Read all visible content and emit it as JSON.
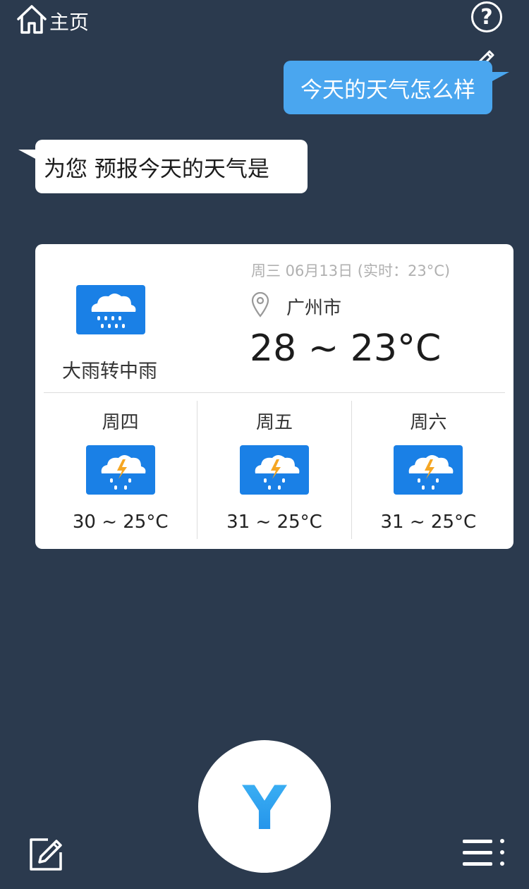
{
  "header": {
    "home_label": "主页",
    "help_label": "?"
  },
  "chat": {
    "user_message": "今天的天气怎么样",
    "bot_message": "为您 预报今天的天气是"
  },
  "weather": {
    "date_line": "周三 06月13日 (实时：23°C)",
    "city": "广州市",
    "temp_range": "28 ~ 23°C",
    "condition": "大雨转中雨",
    "condition_icon": "heavy-rain-icon",
    "forecast": [
      {
        "day": "周四",
        "range": "30 ~ 25°C",
        "icon": "thunderstorm-rain-icon"
      },
      {
        "day": "周五",
        "range": "31 ~ 25°C",
        "icon": "thunderstorm-rain-icon"
      },
      {
        "day": "周六",
        "range": "31 ~ 25°C",
        "icon": "thunderstorm-rain-icon"
      }
    ]
  },
  "colors": {
    "background": "#2b3a4e",
    "user_bubble": "#4aa6ef",
    "icon_blue": "#1a80e6",
    "lightning": "#f5a623"
  },
  "bottom_bar": {
    "mic_logo": "Y"
  }
}
